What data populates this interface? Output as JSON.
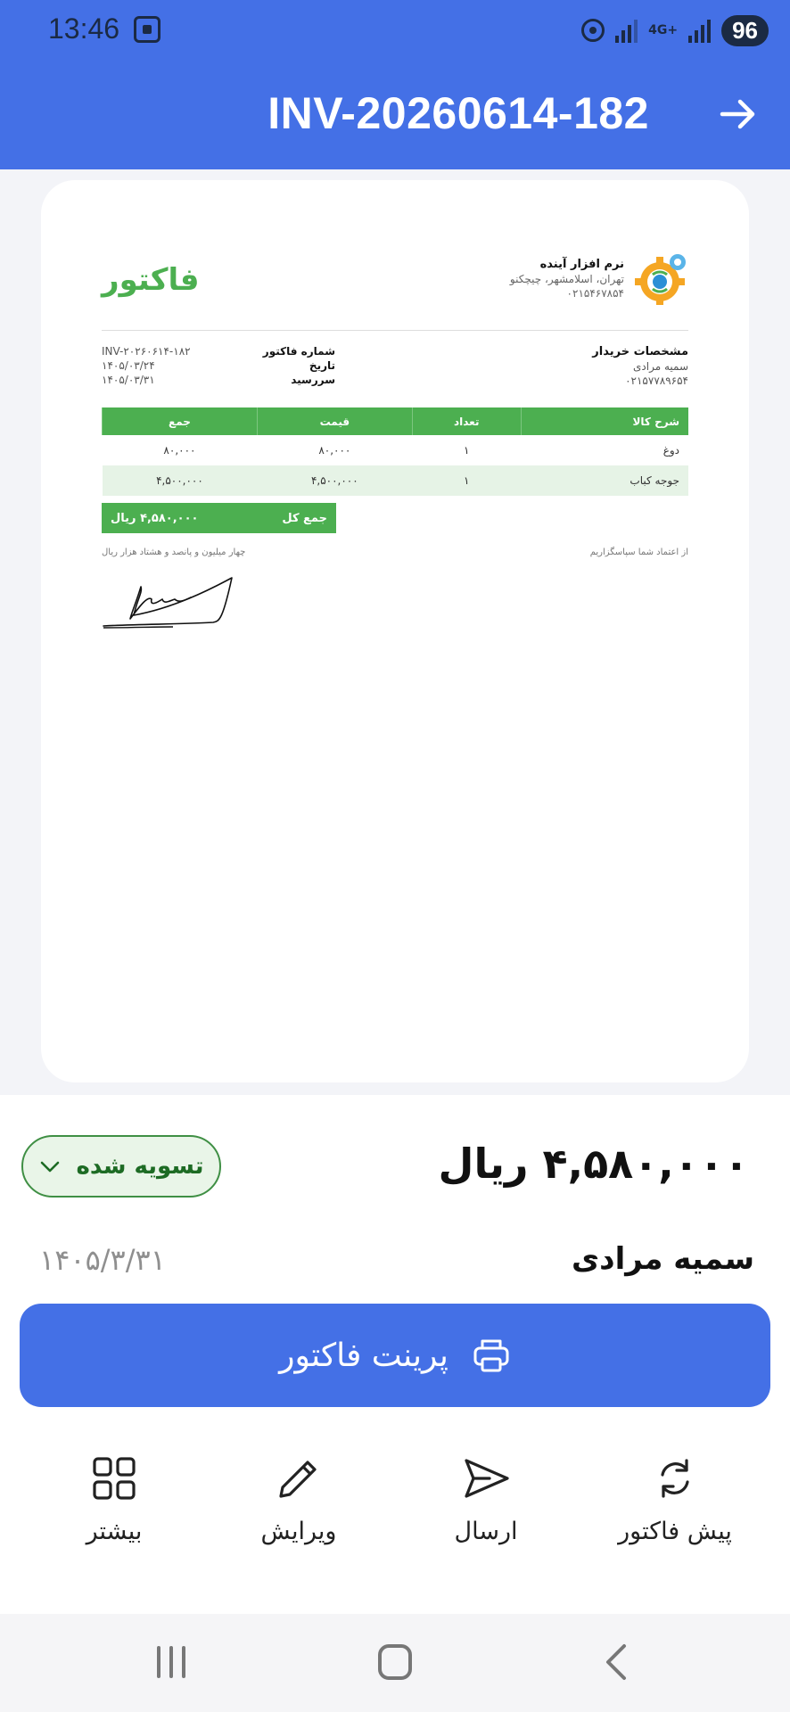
{
  "status_bar": {
    "time": "13:46",
    "network": "4G+",
    "battery": "96"
  },
  "header": {
    "title": "INV-20260614-182"
  },
  "invoice": {
    "title": "فاکتور",
    "company": {
      "name": "نرم افزار آینده",
      "address": "تهران، اسلامشهر، چیچکنو",
      "phone": "۰۲۱۵۴۶۷۸۵۴"
    },
    "buyer": {
      "heading": "مشخصات خریدار",
      "name": "سمیه مرادی",
      "phone": "۰۲۱۵۷۷۸۹۶۵۴"
    },
    "meta": {
      "number_label": "شماره فاکتور",
      "date_label": "تاریخ",
      "due_label": "سررسید",
      "number": "INV-۲۰۲۶۰۶۱۴-۱۸۲",
      "date": "۱۴۰۵/۰۳/۲۴",
      "due": "۱۴۰۵/۰۳/۳۱"
    },
    "columns": {
      "desc": "شرح کالا",
      "qty": "تعداد",
      "price": "قیمت",
      "sum": "جمع"
    },
    "items": [
      {
        "desc": "دوغ",
        "qty": "۱",
        "price": "۸۰,۰۰۰",
        "sum": "۸۰,۰۰۰"
      },
      {
        "desc": "جوجه کباب",
        "qty": "۱",
        "price": "۴,۵۰۰,۰۰۰",
        "sum": "۴,۵۰۰,۰۰۰"
      }
    ],
    "grand_total_label": "جمع کل",
    "grand_total": "۴,۵۸۰,۰۰۰ ریال",
    "amount_in_words": "چهار میلیون و پانصد و هشتاد هزار ریال",
    "thanks": "از اعتماد شما سپاسگزاریم"
  },
  "summary": {
    "amount": "۴,۵۸۰,۰۰۰ ریال",
    "status": "تسویه شده",
    "customer": "سمیه مرادی",
    "date": "۱۴۰۵/۳/۳۱"
  },
  "print_button": "پرینت فاکتور",
  "actions": [
    {
      "label": "پیش فاکتور",
      "icon": "refresh-icon"
    },
    {
      "label": "ارسال",
      "icon": "send-icon"
    },
    {
      "label": "ویرایش",
      "icon": "edit-icon"
    },
    {
      "label": "بیشتر",
      "icon": "grid-icon"
    }
  ],
  "colors": {
    "primary": "#4470e6",
    "invoice_green": "#4caf50",
    "status_green": "#1d6b24"
  }
}
